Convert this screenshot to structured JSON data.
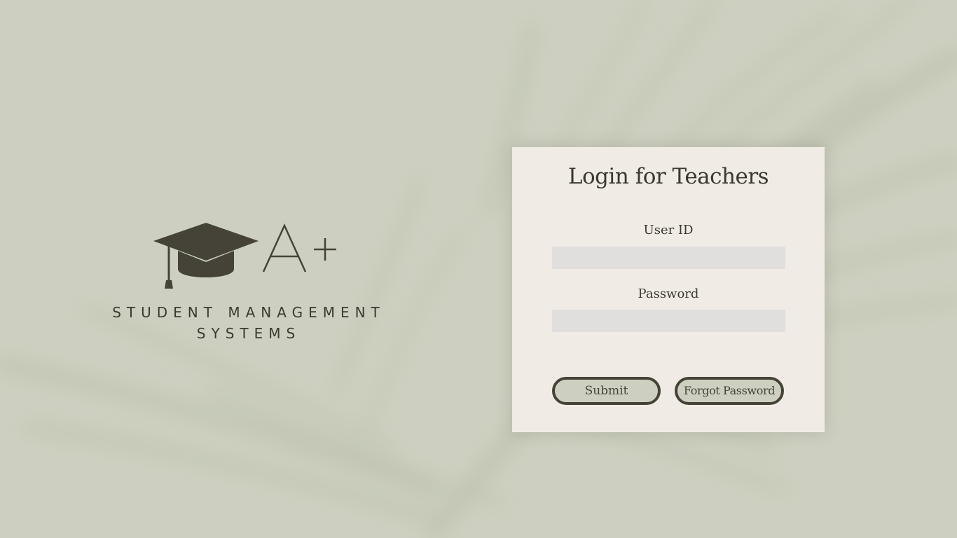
{
  "background": {
    "color": "#cdd0c0"
  },
  "branding": {
    "logo_icon": "graduation-cap-icon",
    "logo_mark_text": "A+",
    "line1": "STUDENT MANAGEMENT",
    "line2": "SYSTEMS",
    "color": "#3c3a30"
  },
  "login": {
    "title": "Login for Teachers",
    "user_id_label": "User ID",
    "user_id_value": "",
    "password_label": "Password",
    "password_value": "",
    "submit_label": "Submit",
    "forgot_label": "Forgot Password",
    "card_color": "#f0ece5",
    "input_color": "#e0dfdd",
    "button_border_color": "#454337"
  }
}
